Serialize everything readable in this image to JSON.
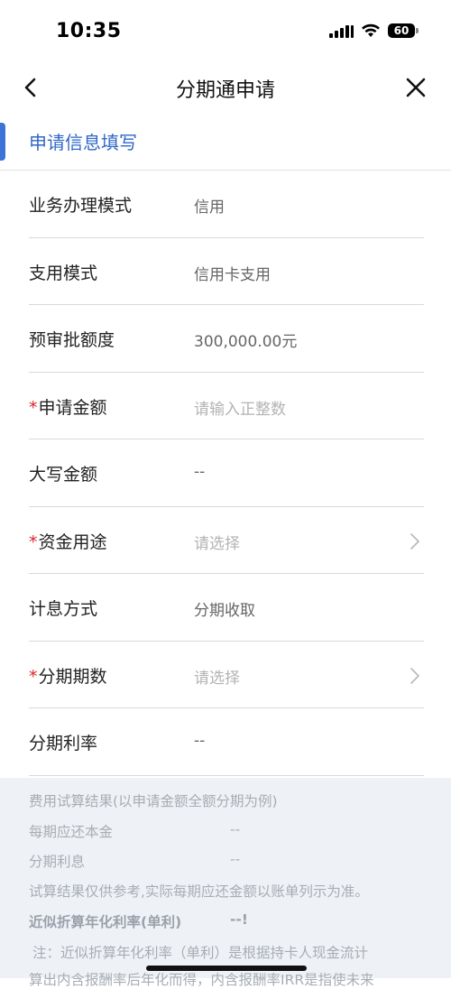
{
  "status": {
    "time": "10:35",
    "battery": "60"
  },
  "nav": {
    "title": "分期通申请"
  },
  "section": {
    "title": "申请信息填写"
  },
  "form": {
    "rows": [
      {
        "label": "业务办理模式",
        "value": "信用",
        "required": false,
        "placeholder": false,
        "chevron": false
      },
      {
        "label": "支用模式",
        "value": "信用卡支用",
        "required": false,
        "placeholder": false,
        "chevron": false
      },
      {
        "label": "预审批额度",
        "value": "300,000.00元",
        "required": false,
        "placeholder": false,
        "chevron": false
      },
      {
        "label": "申请金额",
        "value": "请输入正整数",
        "required": true,
        "placeholder": true,
        "chevron": false
      },
      {
        "label": "大写金额",
        "value": "--",
        "required": false,
        "placeholder": false,
        "chevron": false
      },
      {
        "label": "资金用途",
        "value": "请选择",
        "required": true,
        "placeholder": true,
        "chevron": true
      },
      {
        "label": "计息方式",
        "value": "分期收取",
        "required": false,
        "placeholder": false,
        "chevron": false
      },
      {
        "label": "分期期数",
        "value": "请选择",
        "required": true,
        "placeholder": true,
        "chevron": true
      },
      {
        "label": "分期利率",
        "value": "--",
        "required": false,
        "placeholder": false,
        "chevron": false
      }
    ],
    "required_mark": "*"
  },
  "calc": {
    "heading": "费用试算结果(以申请金额全额分期为例)",
    "principal_label": "每期应还本金",
    "principal_value": "--",
    "interest_label": "分期利息",
    "interest_value": "--",
    "disclaimer": "试算结果仅供参考,实际每期应还金额以账单列示为准。",
    "apr_label": "近似折算年化利率(单利)",
    "apr_value": "--!",
    "note_line1": "注：近似折算年化利率（单利）是根据持卡人现金流计",
    "note_line2": "算出内含报酬率后年化而得，内含报酬率IRR是指使未来"
  }
}
